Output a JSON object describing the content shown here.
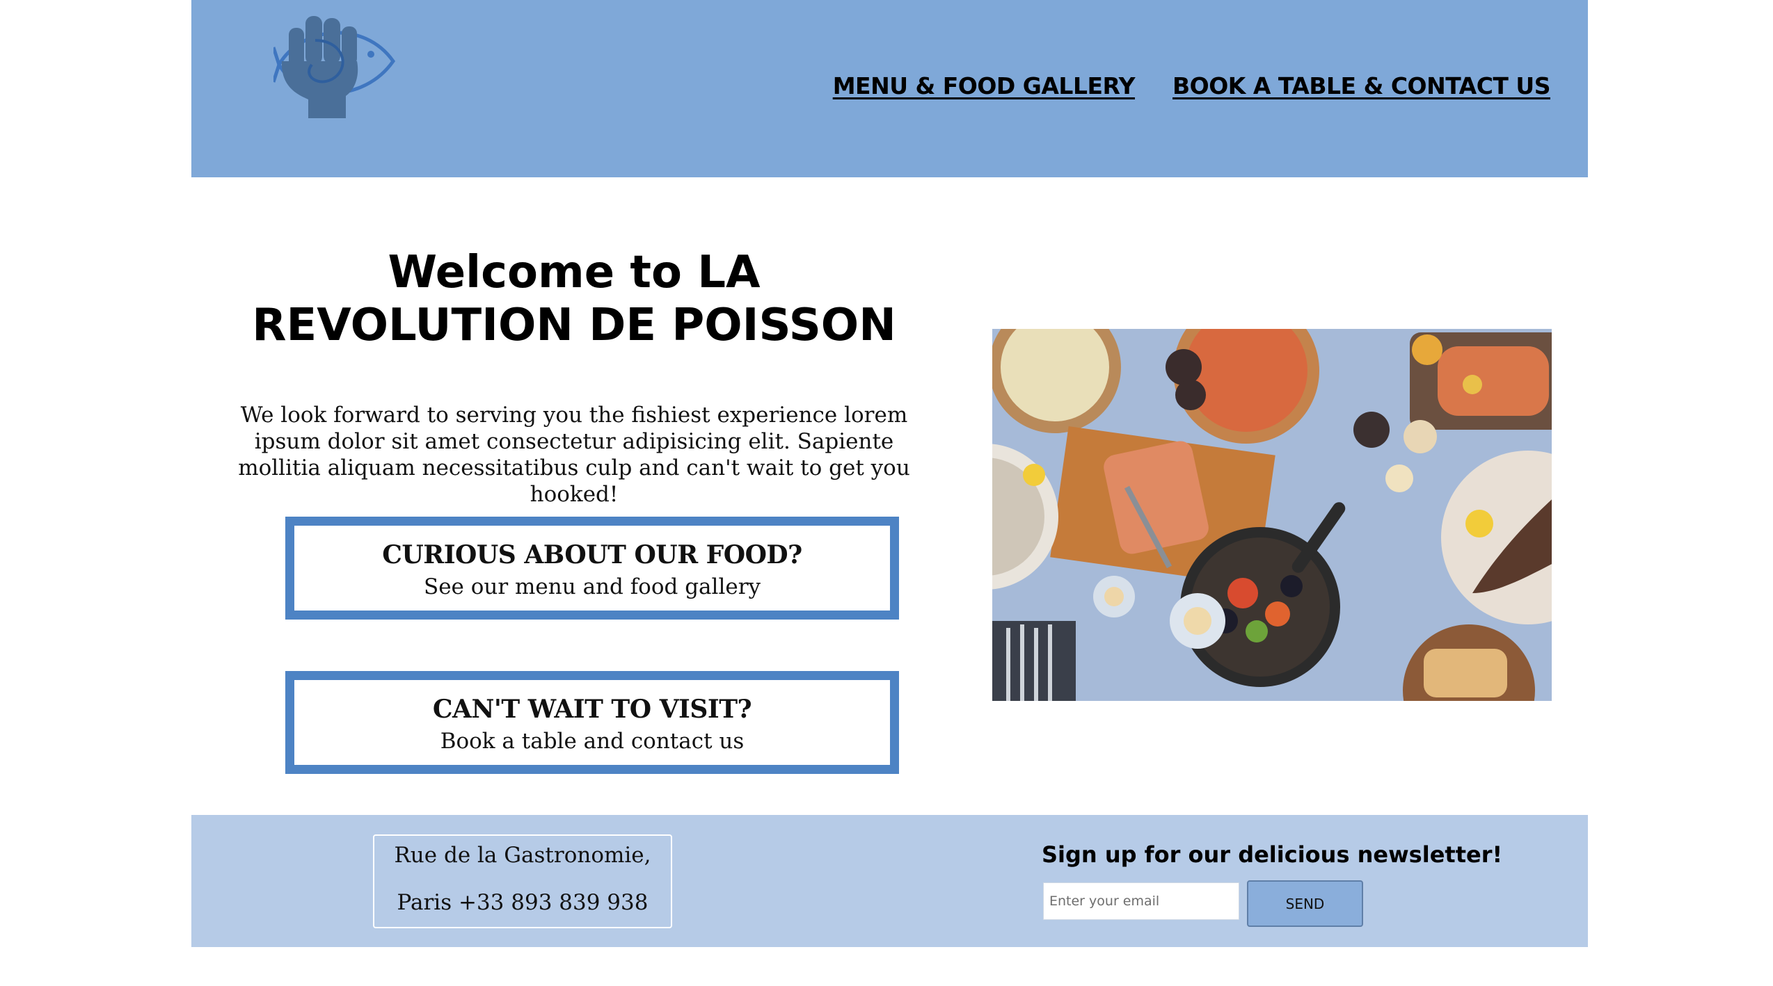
{
  "header": {
    "logo": "raised-fist-fish-logo",
    "nav": [
      {
        "label": "MENU & FOOD GALLERY"
      },
      {
        "label": "BOOK A TABLE & CONTACT US"
      }
    ]
  },
  "main": {
    "title": "Welcome to LA REVOLUTION DE POISSON",
    "intro": "We look forward to serving you the fishiest experience lorem ipsum dolor sit amet consectetur adipisicing elit. Sapiente mollitia aliquam necessitatibus culp and can't wait to get you hooked!",
    "cta_food": {
      "title": "CURIOUS ABOUT OUR FOOD?",
      "subtitle": "See our menu and food gallery"
    },
    "cta_visit": {
      "title": "CAN'T WAIT TO VISIT?",
      "subtitle": "Book a table and contact us"
    },
    "photo": "seafood-table-spread-photo"
  },
  "footer": {
    "address_line1": "Rue de la Gastronomie,",
    "address_line2": "Paris +33 893 839 938",
    "newsletter_title": "Sign up for our delicious newsletter!",
    "email_placeholder": "Enter your email",
    "send_label": "SEND"
  },
  "colors": {
    "header_bg": "#7fa8d8",
    "footer_bg": "#b6cbe7",
    "cta_border": "#4d83c4",
    "send_bg": "#8aaedb"
  }
}
